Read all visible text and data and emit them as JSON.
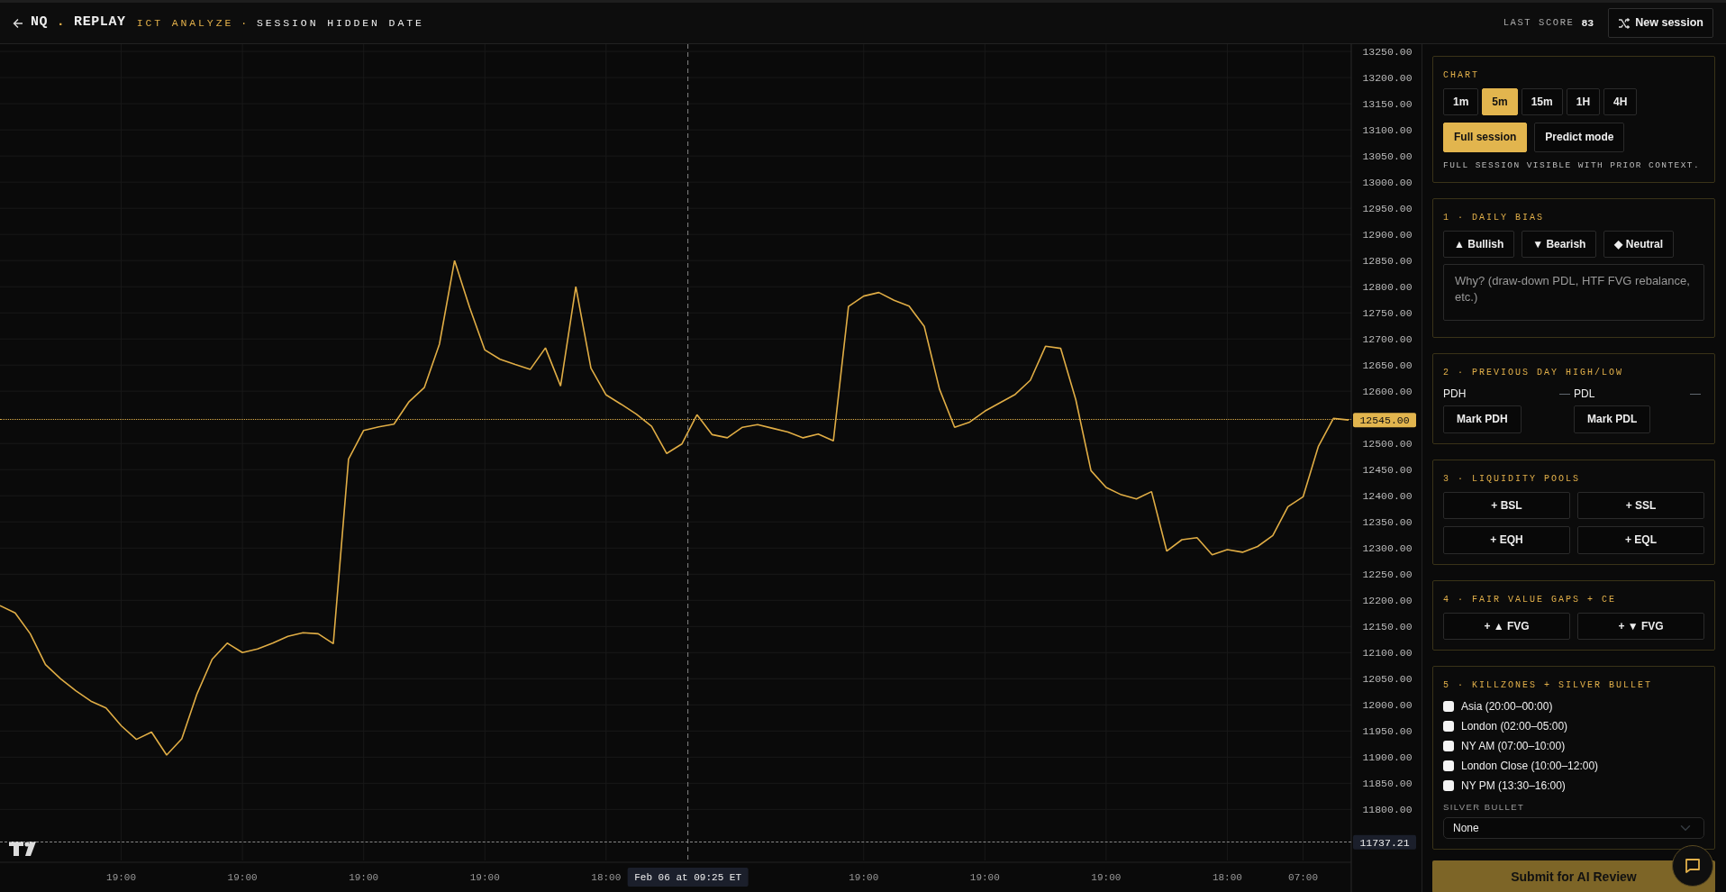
{
  "header": {
    "brand": {
      "left": "NQ",
      "dot": ".",
      "right": "REPLAY"
    },
    "mode": "ICT ANALYZE",
    "separator": "·",
    "session": "SESSION HIDDEN DATE",
    "last_score_label": "LAST SCORE",
    "last_score": "83",
    "new_session_button": "New session"
  },
  "chart": {
    "chart_data": {
      "type": "line",
      "ylim": [
        11642,
        13264
      ],
      "grid": true,
      "categories": [
        null,
        null,
        null,
        null,
        null,
        null,
        null,
        null,
        "19:00",
        null,
        null,
        null,
        null,
        null,
        null,
        null,
        "19:00",
        null,
        null,
        null,
        null,
        null,
        null,
        null,
        "19:00",
        null,
        null,
        null,
        null,
        null,
        null,
        null,
        "19:00",
        null,
        null,
        null,
        null,
        null,
        null,
        null,
        "18:00",
        null,
        null,
        null,
        null,
        null,
        null,
        null,
        null,
        null,
        null,
        null,
        null,
        null,
        null,
        null,
        null,
        "19:00",
        null,
        null,
        null,
        null,
        null,
        null,
        null,
        "19:00",
        null,
        null,
        null,
        null,
        null,
        null,
        null,
        "19:00",
        null,
        null,
        null,
        null,
        null,
        null,
        null,
        "18:00",
        null,
        null,
        null,
        null,
        "07:00",
        null,
        null,
        null
      ],
      "series": [
        {
          "color": "#e0ad45",
          "values": [
            12190,
            12176,
            12136,
            12077,
            12050,
            12027,
            12007,
            11994,
            11960,
            11934,
            11948,
            11904,
            11935,
            12021,
            12087,
            12118,
            12100,
            12107,
            12118,
            12131,
            12138,
            12136,
            12117,
            12470,
            12525,
            12532,
            12537,
            12580,
            12607,
            12690,
            12850,
            12760,
            12679,
            12661,
            12651,
            12642,
            12683,
            12610,
            12800,
            12644,
            12593,
            12575,
            12556,
            12533,
            12481,
            12499,
            12555,
            12517,
            12511,
            12531,
            12536,
            12529,
            12522,
            12511,
            12518,
            12505,
            12762,
            12782,
            12789,
            12774,
            12763,
            12724,
            12604,
            12531,
            12541,
            12562,
            12578,
            12594,
            12621,
            12686,
            12682,
            12584,
            12448,
            12416,
            12402,
            12394,
            12408,
            12294,
            12316,
            12320,
            12287,
            12297,
            12292,
            12303,
            12324,
            12379,
            12398,
            12494,
            12548,
            12545
          ]
        }
      ],
      "yticks": [
        {
          "value": 11800,
          "label": "11800.00"
        },
        {
          "value": 11850,
          "label": "11850.00"
        },
        {
          "value": 11900,
          "label": "11900.00"
        },
        {
          "value": 11950,
          "label": "11950.00"
        },
        {
          "value": 12000,
          "label": "12000.00"
        },
        {
          "value": 12050,
          "label": "12050.00"
        },
        {
          "value": 12100,
          "label": "12100.00"
        },
        {
          "value": 12150,
          "label": "12150.00"
        },
        {
          "value": 12200,
          "label": "12200.00"
        },
        {
          "value": 12250,
          "label": "12250.00"
        },
        {
          "value": 12300,
          "label": "12300.00"
        },
        {
          "value": 12350,
          "label": "12350.00"
        },
        {
          "value": 12400,
          "label": "12400.00"
        },
        {
          "value": 12450,
          "label": "12450.00"
        },
        {
          "value": 12500,
          "label": "12500.00"
        },
        {
          "value": 12600,
          "label": "12600.00"
        },
        {
          "value": 12650,
          "label": "12650.00"
        },
        {
          "value": 12700,
          "label": "12700.00"
        },
        {
          "value": 12750,
          "label": "12750.00"
        },
        {
          "value": 12800,
          "label": "12800.00"
        },
        {
          "value": 12850,
          "label": "12850.00"
        },
        {
          "value": 12900,
          "label": "12900.00"
        },
        {
          "value": 12950,
          "label": "12950.00"
        },
        {
          "value": 13000,
          "label": "13000.00"
        },
        {
          "value": 13050,
          "label": "13050.00"
        },
        {
          "value": 13100,
          "label": "13100.00"
        },
        {
          "value": 13150,
          "label": "13150.00"
        },
        {
          "value": 13200,
          "label": "13200.00"
        },
        {
          "value": 13250,
          "label": "13250.00"
        }
      ],
      "ref_lines": [
        {
          "axis": "y",
          "value": 12545,
          "label": "12545.00"
        },
        {
          "axis": "y",
          "value": 11737.21,
          "label": "11737.21"
        }
      ],
      "annotations": [
        "Feb 06 at 09:25 ET"
      ]
    }
  },
  "panel": {
    "chart_settings": {
      "title": "CHART",
      "timeframes": [
        {
          "label": "1m",
          "selected": false
        },
        {
          "label": "5m",
          "selected": true
        },
        {
          "label": "15m",
          "selected": false
        },
        {
          "label": "1H",
          "selected": false
        },
        {
          "label": "4H",
          "selected": false
        }
      ],
      "views": [
        {
          "label": "Full session",
          "selected": true
        },
        {
          "label": "Predict mode",
          "selected": false
        }
      ],
      "note": "FULL SESSION VISIBLE WITH PRIOR CONTEXT."
    },
    "sections": [
      {
        "kind": "bias",
        "title": "1 · DAILY BIAS",
        "options": [
          {
            "label": "▲ Bullish",
            "selected": false
          },
          {
            "label": "▼ Bearish",
            "selected": false
          },
          {
            "label": "◆ Neutral",
            "selected": false
          }
        ],
        "placeholder": "Why? (draw-down PDL, HTF FVG rebalance, etc.)"
      },
      {
        "kind": "levels",
        "title": "2 · PREVIOUS DAY HIGH/LOW",
        "levels": [
          {
            "label": "PDH",
            "value": "—",
            "button": "Mark PDH"
          },
          {
            "label": "PDL",
            "value": "—",
            "button": "Mark PDL"
          }
        ]
      },
      {
        "kind": "buttons",
        "title": "3 · LIQUIDITY POOLS",
        "buttons": [
          "+ BSL",
          "+ SSL",
          "+ EQH",
          "+ EQL"
        ]
      },
      {
        "kind": "buttons",
        "title": "4 · FAIR VALUE GAPS + CE",
        "buttons": [
          "+ ▲ FVG",
          "+ ▼ FVG"
        ]
      },
      {
        "kind": "killzones",
        "title": "5 · KILLZONES + SILVER BULLET",
        "items": [
          {
            "label": "Asia (20:00–00:00)",
            "checked": false
          },
          {
            "label": "London (02:00–05:00)",
            "checked": false
          },
          {
            "label": "NY AM (07:00–10:00)",
            "checked": false
          },
          {
            "label": "London Close (10:00–12:00)",
            "checked": false
          },
          {
            "label": "NY PM (13:30–16:00)",
            "checked": false
          }
        ],
        "select_label": "SILVER BULLET",
        "select_value": "None"
      }
    ],
    "submit_button": "Submit for AI Review"
  }
}
